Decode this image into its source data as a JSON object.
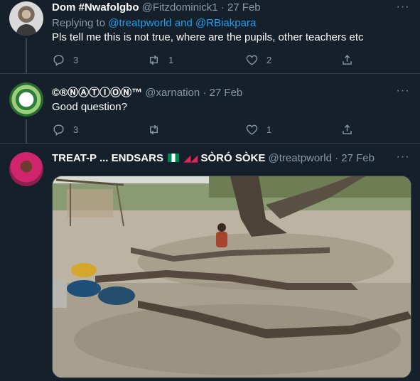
{
  "tweets": [
    {
      "name": "Dom #Nwafolgbo",
      "handle": "@Fitzdominick1",
      "date": "27 Feb",
      "replying_prefix": "Replying to",
      "replying_user1": "@treatpworld",
      "replying_and": "and",
      "replying_user2": "@RBiakpara",
      "text": "Pls tell me this is not true, where are the pupils, other teachers etc",
      "reply_count": "3",
      "retweet_count": "1",
      "like_count": "2"
    },
    {
      "name": "©®ⓃⒶⓉⒾⓄⓃ™",
      "handle": "@xarnation",
      "date": "27 Feb",
      "text": "Good question?",
      "reply_count": "3",
      "retweet_count": "",
      "like_count": "1"
    },
    {
      "name_part1": "TREAT-P ... ENDSARS",
      "name_part2": "SÒRÓ SÒKE",
      "handle": "@treatpworld",
      "date": "27 Feb",
      "media_description_icon": "photo"
    }
  ],
  "separator": "·",
  "more_label": "···",
  "colors": {
    "background": "#15202b",
    "border": "#38444d",
    "muted": "#8899a6",
    "link": "#1da1f2"
  }
}
